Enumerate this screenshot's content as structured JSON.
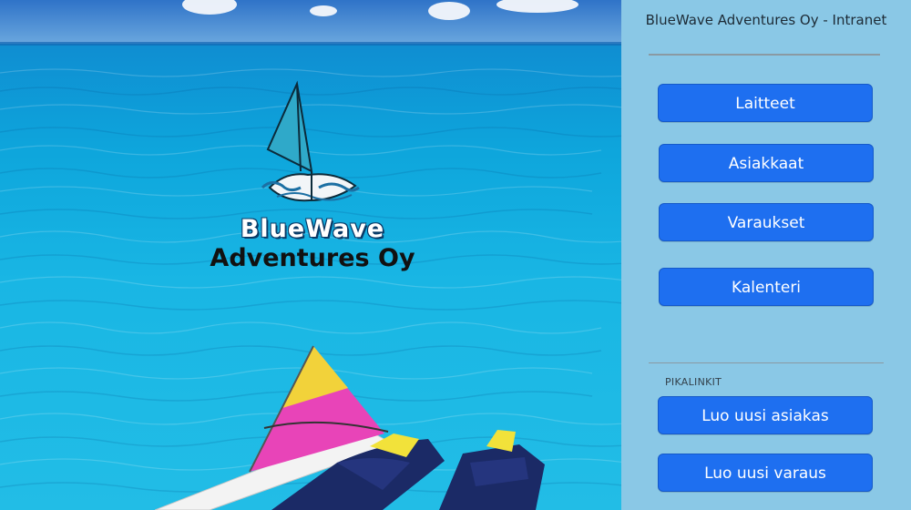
{
  "sidebar": {
    "title": "BlueWave Adventures Oy - Intranet",
    "nav": [
      {
        "label": "Laitteet"
      },
      {
        "label": "Asiakkaat"
      },
      {
        "label": "Varaukset"
      },
      {
        "label": "Kalenteri"
      }
    ],
    "quicklinks_label": "PIKALINKIT",
    "quicklinks": [
      {
        "label": "Luo uusi asiakas"
      },
      {
        "label": "Luo uusi varaus"
      }
    ]
  },
  "hero": {
    "logo_line1": "BlueWave",
    "logo_line2": "Adventures Oy"
  },
  "colors": {
    "sidebar_bg": "#8ac8e6",
    "button_bg": "#1e6ff0",
    "button_text": "#ffffff",
    "sea": "#19b6e4"
  }
}
